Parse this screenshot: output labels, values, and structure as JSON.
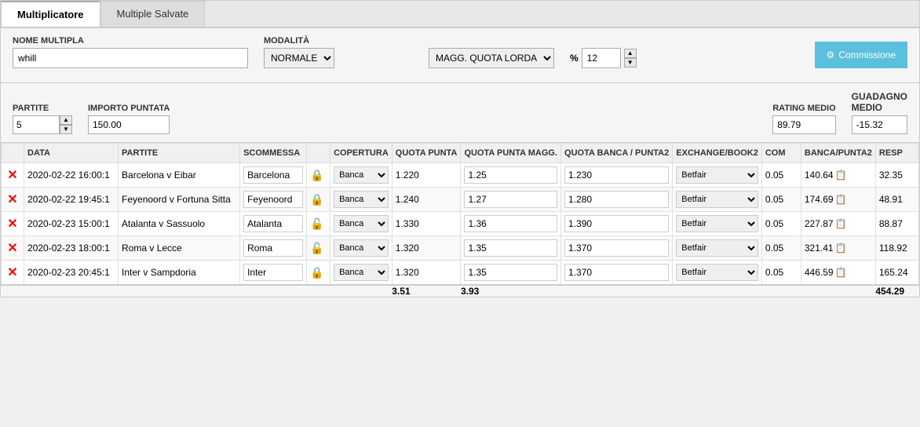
{
  "tabs": [
    {
      "id": "multiplicatore",
      "label": "Multiplicatore",
      "active": true
    },
    {
      "id": "multiple-salvate",
      "label": "Multiple Salvate",
      "active": false
    }
  ],
  "form": {
    "nome_multipla_label": "NOME MULTIPLA",
    "nome_multipla_value": "whill",
    "modalita_label": "MODALITÀ",
    "modalita_value": "NORMALE",
    "modalita_options": [
      "NORMALE"
    ],
    "magg_label": "MAGG. QUOTA LORDA",
    "magg_options": [
      "MAGG. QUOTA LORDA"
    ],
    "pct_symbol": "%",
    "pct_value": "12",
    "commission_btn_label": "Commissione"
  },
  "stats": {
    "partite_label": "PARTITE",
    "partite_value": "5",
    "importo_label": "IMPORTO PUNTATA",
    "importo_value": "150.00",
    "rating_label": "RATING MEDIO",
    "rating_value": "89.79",
    "guadagno_label": "GUADAGNO",
    "guadagno_sub": "MEDIO",
    "guadagno_value": "-15.32"
  },
  "table": {
    "headers": {
      "remove": "",
      "data": "DATA",
      "partite": "PARTITE",
      "scommessa": "SCOMMESSA",
      "lock": "",
      "copertura": "COPERTURA",
      "quota_punta": "QUOTA PUNTA",
      "quota_punta_magg": "QUOTA PUNTA MAGG.",
      "quota_banca_punta2": "QUOTA BANCA / PUNTA2",
      "exchange": "EXCHANGE/BOOK2",
      "com": "COM",
      "banca_punta2": "BANCA/PUNTA2",
      "resp": "RESP"
    },
    "rows": [
      {
        "data": "2020-02-22 16:00:1",
        "partita": "Barcelona v Eibar",
        "scommessa": "Barcelona",
        "lock": "🔒",
        "copertura": "Banca",
        "quota_punta": "1.220",
        "quota_punta_magg": "1.25",
        "quota_banca": "1.230",
        "exchange": "Betfair",
        "com": "0.05",
        "banca_punta2": "140.64",
        "resp": "32.35"
      },
      {
        "data": "2020-02-22 19:45:1",
        "partita": "Feyenoord v Fortuna Sitta",
        "scommessa": "Feyenoord",
        "lock": "🔒",
        "copertura": "Banca",
        "quota_punta": "1.240",
        "quota_punta_magg": "1.27",
        "quota_banca": "1.280",
        "exchange": "Betfair",
        "com": "0.05",
        "banca_punta2": "174.69",
        "resp": "48.91"
      },
      {
        "data": "2020-02-23 15:00:1",
        "partita": "Atalanta v Sassuolo",
        "scommessa": "Atalanta",
        "lock": "🔓",
        "copertura": "Banca",
        "quota_punta": "1.330",
        "quota_punta_magg": "1.36",
        "quota_banca": "1.390",
        "exchange": "Betfair",
        "com": "0.05",
        "banca_punta2": "227.87",
        "resp": "88.87"
      },
      {
        "data": "2020-02-23 18:00:1",
        "partita": "Roma v Lecce",
        "scommessa": "Roma",
        "lock": "🔓",
        "copertura": "Banca",
        "quota_punta": "1.320",
        "quota_punta_magg": "1.35",
        "quota_banca": "1.370",
        "exchange": "Betfair",
        "com": "0.05",
        "banca_punta2": "321.41",
        "resp": "118.92"
      },
      {
        "data": "2020-02-23 20:45:1",
        "partita": "Inter v Sampdoria",
        "scommessa": "Inter",
        "lock": "🔒",
        "copertura": "Banca",
        "quota_punta": "1.320",
        "quota_punta_magg": "1.35",
        "quota_banca": "1.370",
        "exchange": "Betfair",
        "com": "0.05",
        "banca_punta2": "446.59",
        "resp": "165.24"
      }
    ],
    "footer": {
      "quota_punta_total": "3.51",
      "quota_punta_magg_total": "3.93",
      "resp_total": "454.29"
    }
  }
}
